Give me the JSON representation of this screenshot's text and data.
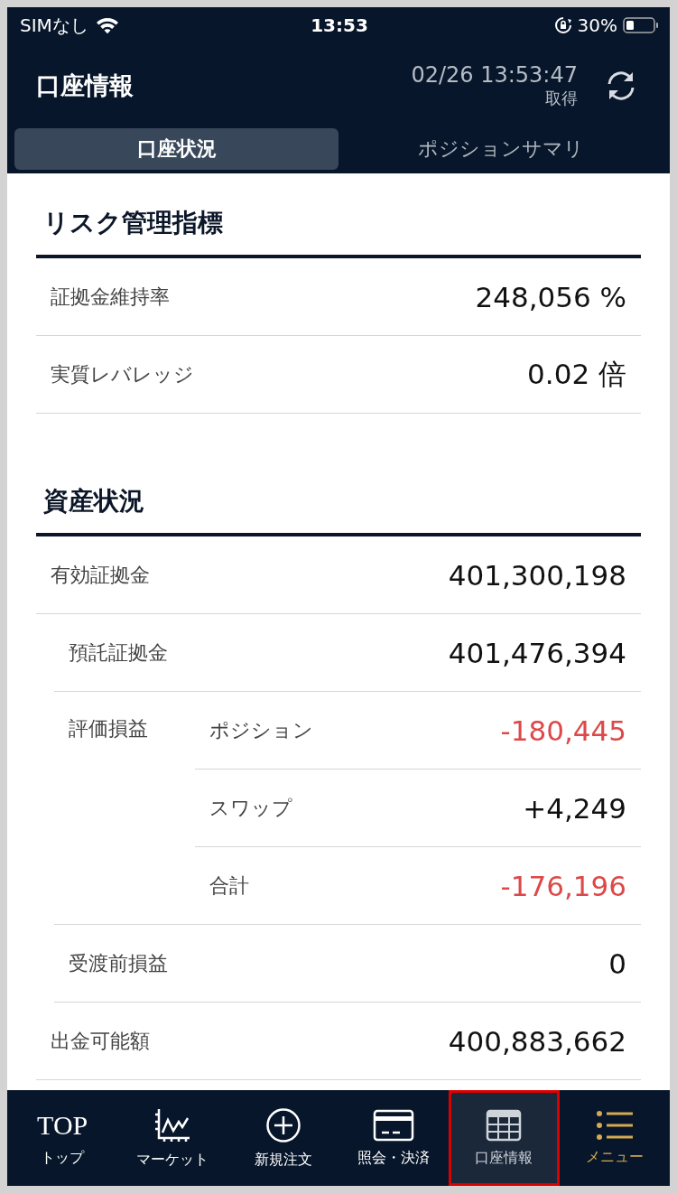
{
  "status_bar": {
    "carrier": "SIMなし",
    "time": "13:53",
    "battery": "30%"
  },
  "header": {
    "title": "口座情報",
    "timestamp": "02/26 13:53:47",
    "timestamp_label": "取得"
  },
  "tabs": [
    {
      "label": "口座状況",
      "selected": true
    },
    {
      "label": "ポジションサマリ",
      "selected": false
    }
  ],
  "sections": [
    {
      "title": "リスク管理指標",
      "rows": [
        {
          "kind": "row",
          "label": "証拠金維持率",
          "value": "248,056 %",
          "indent": false,
          "negative": false
        },
        {
          "kind": "row",
          "label": "実質レバレッジ",
          "value": "0.02 倍",
          "indent": false,
          "negative": false
        }
      ]
    },
    {
      "title": "資産状況",
      "rows": [
        {
          "kind": "row",
          "label": "有効証拠金",
          "value": "401,300,198",
          "indent": false,
          "negative": false
        },
        {
          "kind": "row",
          "label": "預託証拠金",
          "value": "401,476,394",
          "indent": true,
          "negative": false
        },
        {
          "kind": "group",
          "label": "評価損益",
          "rows": [
            {
              "label": "ポジション",
              "value": "-180,445",
              "negative": true
            },
            {
              "label": "スワップ",
              "value": "+4,249",
              "negative": false
            },
            {
              "label": "合計",
              "value": "-176,196",
              "negative": true
            }
          ]
        },
        {
          "kind": "row",
          "label": "受渡前損益",
          "value": "0",
          "indent": true,
          "negative": false
        },
        {
          "kind": "row",
          "label": "出金可能額",
          "value": "400,883,662",
          "indent": false,
          "negative": false
        }
      ]
    }
  ],
  "bottom_nav": [
    {
      "kind": "top",
      "icon_text": "TOP",
      "label": "トップ",
      "selected": false
    },
    {
      "kind": "chart",
      "label": "マーケット",
      "selected": false
    },
    {
      "kind": "plus",
      "label": "新規注文",
      "selected": false
    },
    {
      "kind": "card",
      "label": "照会・決済",
      "selected": false
    },
    {
      "kind": "table",
      "label": "口座情報",
      "selected": true
    },
    {
      "kind": "menu",
      "label": "メニュー",
      "selected": false
    }
  ]
}
